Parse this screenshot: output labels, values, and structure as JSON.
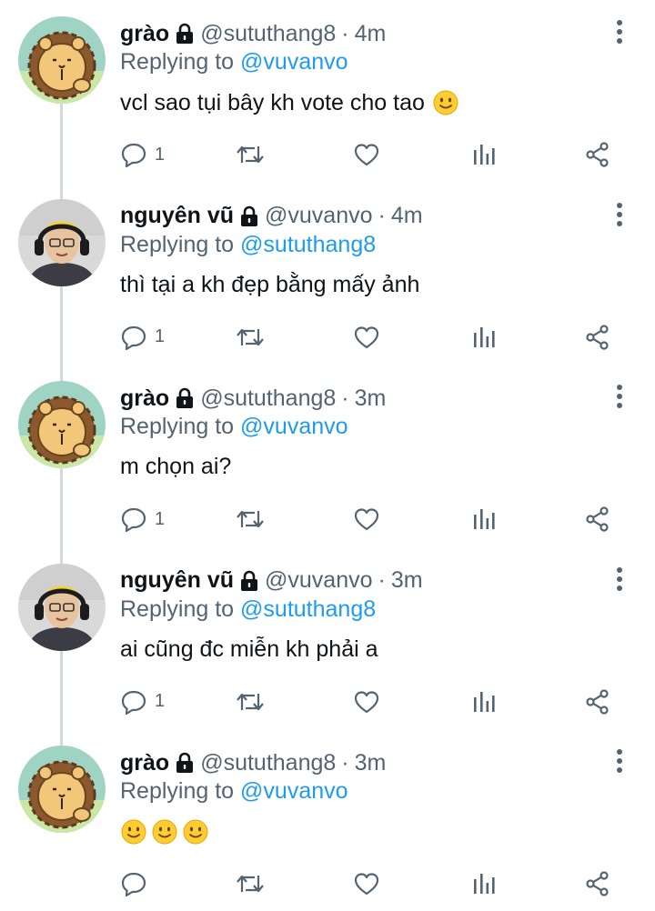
{
  "colors": {
    "accent": "#1d9bf0",
    "secondary": "#536471",
    "line": "#cfd9de"
  },
  "tweets": [
    {
      "avatar": "lion-avatar",
      "name": "grào",
      "handle": "@sututhang8",
      "sep": "·",
      "time": "4m",
      "replying_prefix": "Replying to ",
      "replying_to": "@vuvanvo",
      "text": "vcl sao tụi bây kh vote cho tao",
      "emoji_count": 1,
      "reply_count": "1"
    },
    {
      "avatar": "person-avatar",
      "name": "nguyên vũ",
      "handle": "@vuvanvo",
      "sep": "·",
      "time": "4m",
      "replying_prefix": "Replying to ",
      "replying_to": "@sututhang8",
      "text": "thì tại a kh đẹp bằng mấy ảnh",
      "emoji_count": 0,
      "reply_count": "1"
    },
    {
      "avatar": "lion-avatar",
      "name": "grào",
      "handle": "@sututhang8",
      "sep": "·",
      "time": "3m",
      "replying_prefix": "Replying to ",
      "replying_to": "@vuvanvo",
      "text": "m chọn ai?",
      "emoji_count": 0,
      "reply_count": "1"
    },
    {
      "avatar": "person-avatar",
      "name": "nguyên vũ",
      "handle": "@vuvanvo",
      "sep": "·",
      "time": "3m",
      "replying_prefix": "Replying to ",
      "replying_to": "@sututhang8",
      "text": "ai cũng đc miễn kh phải a",
      "emoji_count": 0,
      "reply_count": "1"
    },
    {
      "avatar": "lion-avatar",
      "name": "grào",
      "handle": "@sututhang8",
      "sep": "·",
      "time": "3m",
      "replying_prefix": "Replying to ",
      "replying_to": "@vuvanvo",
      "text": "",
      "emoji_count": 3,
      "reply_count": ""
    }
  ]
}
